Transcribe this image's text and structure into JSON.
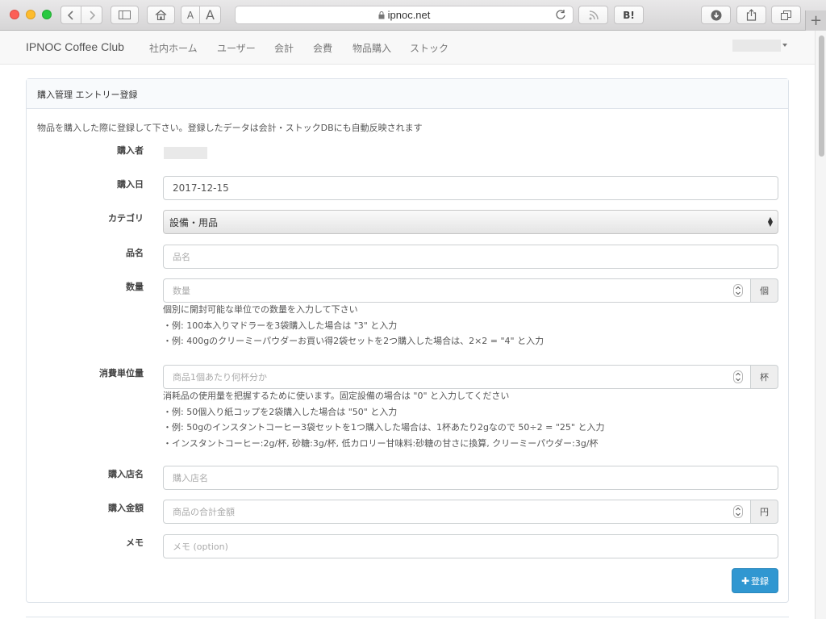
{
  "browser": {
    "url": "ipnoc.net",
    "font_small_label": "A",
    "font_large_label": "A",
    "hatena_label": "B!",
    "new_tab_label": "+"
  },
  "navbar": {
    "brand": "IPNOC Coffee Club",
    "items": [
      "社内ホーム",
      "ユーザー",
      "会計",
      "会費",
      "物品購入",
      "ストック"
    ]
  },
  "panel": {
    "heading": "購入管理 エントリー登録",
    "intro": "物品を購入した際に登録して下さい。登録したデータは会計・ストックDBにも自動反映されます"
  },
  "form": {
    "purchaser": {
      "label": "購入者"
    },
    "date": {
      "label": "購入日",
      "value": "2017-12-15"
    },
    "category": {
      "label": "カテゴリ",
      "selected": "設備・用品"
    },
    "item_name": {
      "label": "品名",
      "placeholder": "品名"
    },
    "quantity": {
      "label": "数量",
      "placeholder": "数量",
      "unit": "個",
      "help": [
        "個別に開封可能な単位での数量を入力して下さい",
        "・例: 100本入りマドラーを3袋購入した場合は \"3\" と入力",
        "・例: 400gのクリーミーパウダーお買い得2袋セットを2つ購入した場合は、2×2 = \"4\" と入力"
      ]
    },
    "consumption_unit": {
      "label": "消費単位量",
      "placeholder": "商品1個あたり何杯分か",
      "unit": "杯",
      "help": [
        "消耗品の使用量を把握するために使います。固定設備の場合は \"0\" と入力してください",
        "・例: 50個入り紙コップを2袋購入した場合は \"50\" と入力",
        "・例: 50gのインスタントコーヒー3袋セットを1つ購入した場合は、1杯あたり2gなので 50÷2 = \"25\" と入力",
        "・インスタントコーヒー:2g/杯, 砂糖:3g/杯, 低カロリー甘味料:砂糖の甘さに換算, クリーミーパウダー:3g/杯"
      ]
    },
    "store": {
      "label": "購入店名",
      "placeholder": "購入店名"
    },
    "amount": {
      "label": "購入金額",
      "placeholder": "商品の合計金額",
      "unit": "円"
    },
    "memo": {
      "label": "メモ",
      "placeholder": "メモ (option)"
    },
    "submit_label": "登録"
  },
  "colors": {
    "primary": "#3097d1"
  }
}
